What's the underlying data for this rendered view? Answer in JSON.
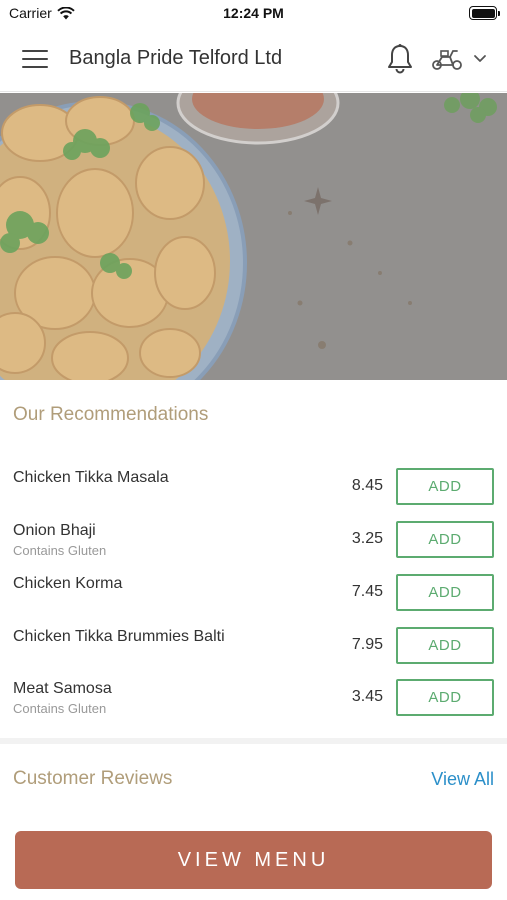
{
  "status_bar": {
    "carrier": "Carrier",
    "time": "12:24 PM"
  },
  "header": {
    "title": "Bangla Pride Telford Ltd",
    "icons": [
      "menu-icon",
      "bell-icon",
      "scooter-icon",
      "chevron-down-icon"
    ]
  },
  "recommendations": {
    "title": "Our Recommendations",
    "add_label": "ADD",
    "items": [
      {
        "name": "Chicken Tikka Masala",
        "note": "",
        "price": "8.45"
      },
      {
        "name": "Onion Bhaji",
        "note": "Contains Gluten",
        "price": "3.25"
      },
      {
        "name": "Chicken Korma",
        "note": "",
        "price": "7.45"
      },
      {
        "name": "Chicken Tikka Brummies Balti",
        "note": "",
        "price": "7.95"
      },
      {
        "name": "Meat Samosa",
        "note": "Contains Gluten",
        "price": "3.45"
      }
    ]
  },
  "reviews": {
    "title": "Customer Reviews",
    "view_all": "View All"
  },
  "footer": {
    "view_menu": "VIEW MENU"
  },
  "colors": {
    "accent_gold": "#b09d7a",
    "add_green": "#5cab70",
    "link_blue": "#2b8fc9",
    "menu_button": "#b86a55"
  }
}
